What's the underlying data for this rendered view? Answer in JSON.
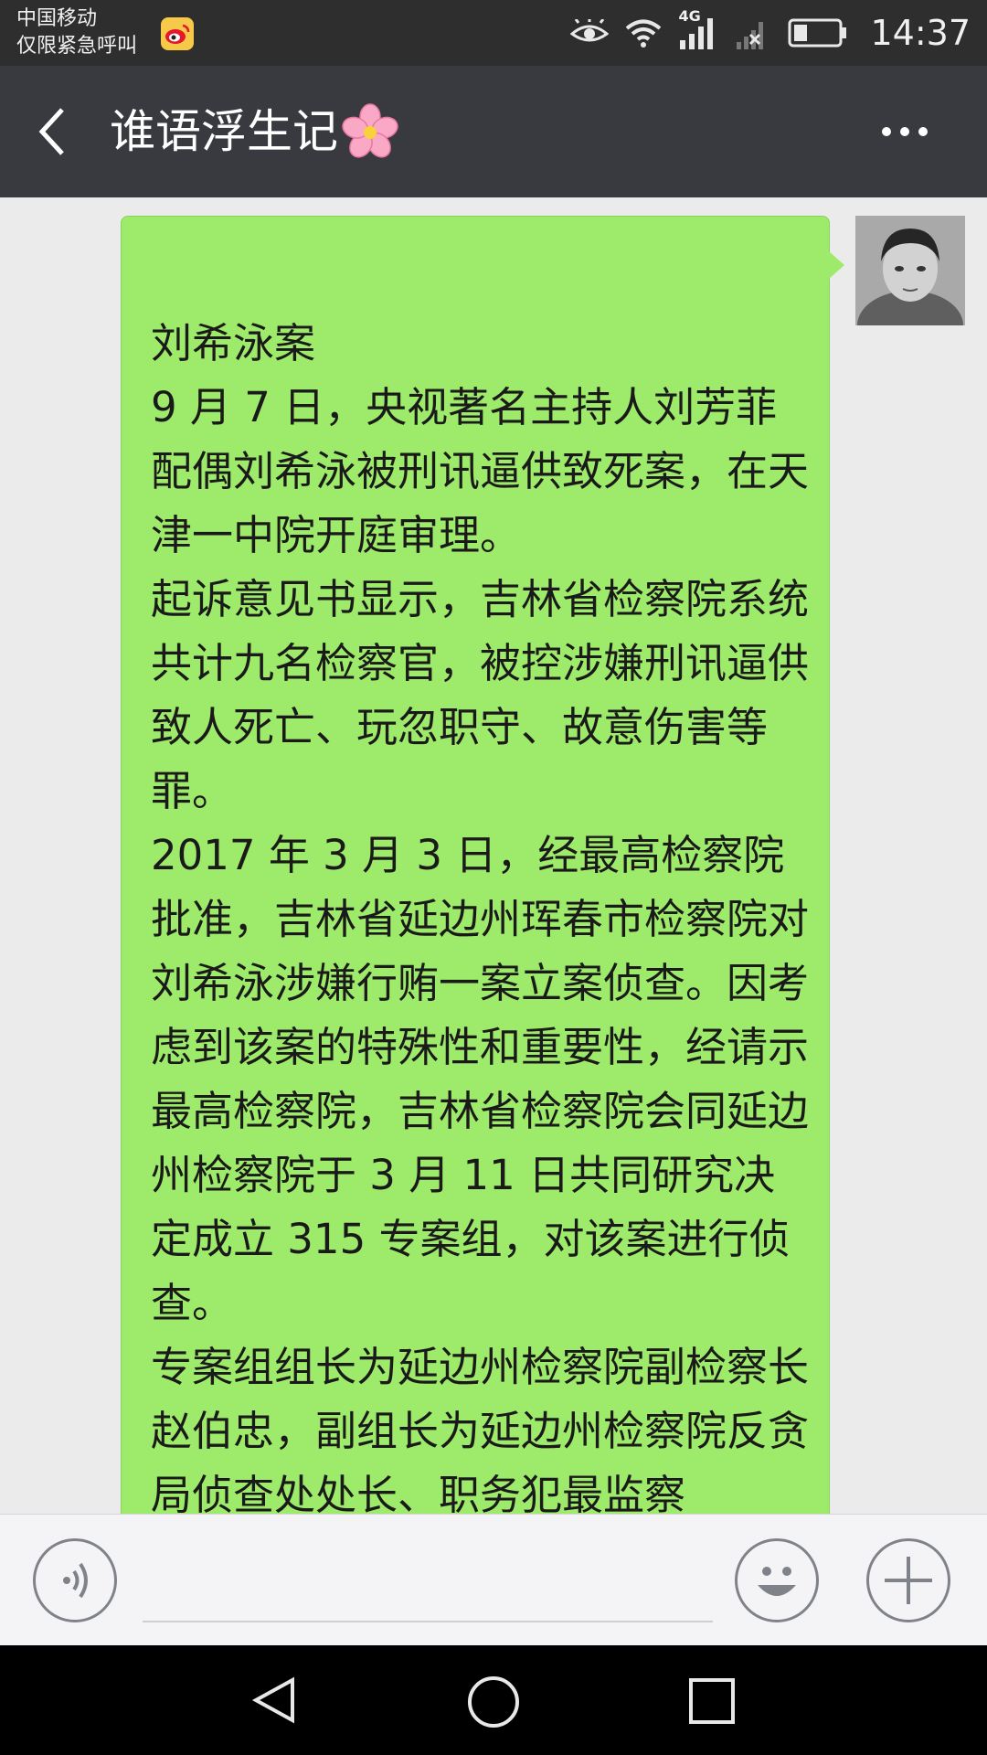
{
  "status_bar": {
    "carrier_line1": "中国移动",
    "carrier_line2": "仅限紧急呼叫",
    "network": "4G",
    "time": "14:37",
    "icons": [
      "weibo-icon",
      "eye-icon",
      "wifi-icon",
      "signal-icon",
      "no-signal-icon",
      "battery-icon"
    ]
  },
  "header": {
    "title": "谁语浮生记",
    "back_icon": "chevron-left-icon",
    "title_emoji": "cherry-blossom-icon",
    "menu_icon": "more-icon"
  },
  "chat": {
    "message": "刘希泳案\n9 月 7 日，央视著名主持人刘芳菲配偶刘希泳被刑讯逼供致死案，在天津一中院开庭审理。\n起诉意见书显示，吉林省检察院系统共计九名检察官，被控涉嫌刑讯逼供致人死亡、玩忽职守、故意伤害等罪。\n2017 年 3 月 3 日，经最高检察院批准，吉林省延边州珲春市检察院对刘希泳涉嫌行贿一案立案侦查。因考虑到该案的特殊性和重要性，经请示最高检察院，吉林省检察院会同延边州检察院于 3 月 11 日共同研究决定成立 315 专案组，对该案进行侦查。\n专案组组长为延边州检察院副检察长赵伯忠，副组长为延边州检察院反贪局侦查处处长、职务犯最监察",
    "bubble_color": "#9eea6a"
  },
  "input_bar": {
    "icons": [
      "voice-icon",
      "emoji-icon",
      "plus-icon"
    ]
  },
  "nav_bar": {
    "icons": [
      "back-triangle-icon",
      "home-circle-icon",
      "recents-square-icon"
    ]
  }
}
